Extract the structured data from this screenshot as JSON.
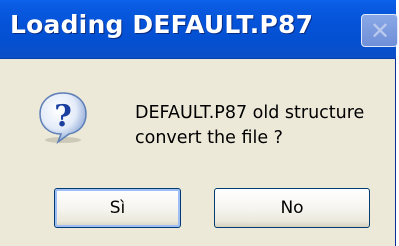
{
  "dialog": {
    "title": "Loading DEFAULT.P87",
    "close_label": "✕",
    "icon": "question-icon",
    "message_line1": "DEFAULT.P87 old structure",
    "message_line2": "convert the file ?",
    "buttons": {
      "yes_label": "Sì",
      "no_label": "No"
    }
  },
  "colors": {
    "titlebar": "#0553d8",
    "dialog_bg": "#ece9d8",
    "button_border": "#003c74"
  }
}
